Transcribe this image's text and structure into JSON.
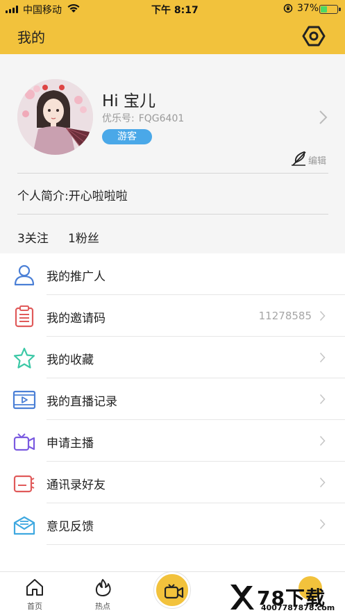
{
  "status_bar": {
    "carrier": "中国移动",
    "time": "下午 8:17",
    "battery_pct": "37%",
    "battery_level": 0.37
  },
  "header": {
    "title": "我的",
    "settings_icon": "hexagon-gear-icon"
  },
  "profile": {
    "greeting": "Hi 宝儿",
    "uid_label": "优乐号:",
    "uid_value": "FQG6401",
    "role": "游客",
    "edit_label": "编辑",
    "bio": "个人简介:开心啦啦啦",
    "follow_text": "3关注",
    "fans_text": "1粉丝"
  },
  "menu": {
    "items": [
      {
        "label": "我的推广人",
        "value": "",
        "icon": "person-icon",
        "color": "#4a7fd6"
      },
      {
        "label": "我的邀请码",
        "value": "11278585",
        "icon": "clipboard-icon",
        "color": "#e05a5a"
      },
      {
        "label": "我的收藏",
        "value": "",
        "icon": "star-icon",
        "color": "#3cc8a6"
      },
      {
        "label": "我的直播记录",
        "value": "",
        "icon": "video-film-icon",
        "color": "#4a7fd6"
      },
      {
        "label": "申请主播",
        "value": "",
        "icon": "camera-icon",
        "color": "#7a5ae0"
      },
      {
        "label": "通讯录好友",
        "value": "",
        "icon": "contacts-icon",
        "color": "#e05a5a"
      },
      {
        "label": "意见反馈",
        "value": "",
        "icon": "feedback-mail-icon",
        "color": "#3ea8e0"
      }
    ]
  },
  "tabbar": {
    "tabs": [
      {
        "label": "首页",
        "icon": "home-icon"
      },
      {
        "label": "热点",
        "icon": "flame-icon"
      }
    ],
    "center_icon": "video-camera-icon"
  },
  "watermark": {
    "text": "78下载",
    "url": "4007787878.com"
  },
  "colors": {
    "brand_yellow": "#f2c23c",
    "badge_blue": "#4aa8e8"
  }
}
